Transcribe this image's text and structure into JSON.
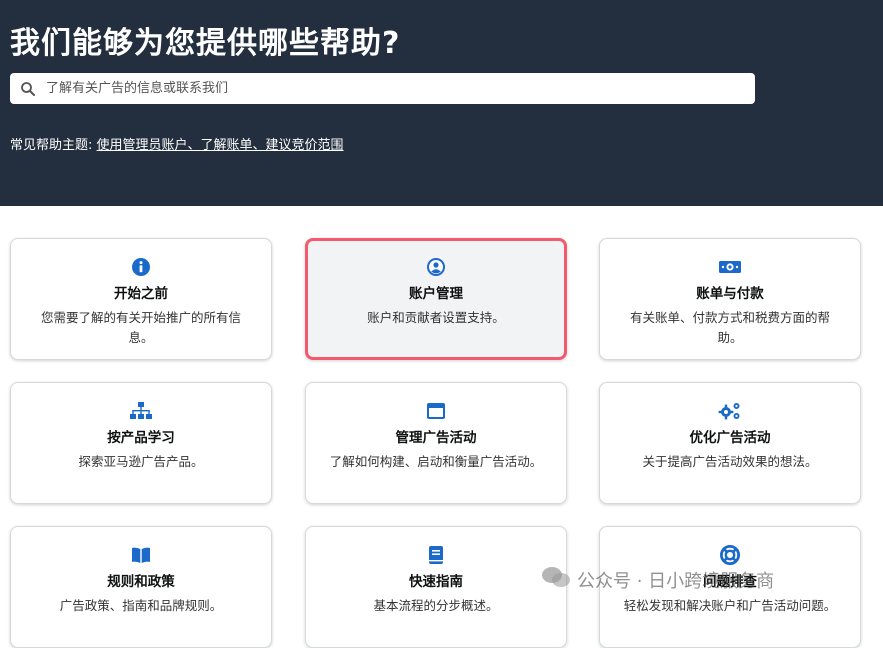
{
  "hero": {
    "title": "我们能够为您提供哪些帮助?",
    "search_placeholder": "了解有关广告的信息或联系我们",
    "topics_prefix": "常见帮助主题:",
    "topics_link": "使用管理员账户、了解账单、建议竞价范围"
  },
  "colors": {
    "hero_bg": "#232f3e",
    "icon_blue": "#1b6ac9",
    "selected_border": "#f25a6e"
  },
  "cards": [
    {
      "icon": "info-icon",
      "title": "开始之前",
      "desc": "您需要了解的有关开始推广的所有信息。"
    },
    {
      "icon": "user-circle-icon",
      "title": "账户管理",
      "desc": "账户和贡献者设置支持。"
    },
    {
      "icon": "money-icon",
      "title": "账单与付款",
      "desc": "有关账单、付款方式和税费方面的帮助。"
    },
    {
      "icon": "sitemap-icon",
      "title": "按产品学习",
      "desc": "探索亚马逊广告产品。"
    },
    {
      "icon": "window-icon",
      "title": "管理广告活动",
      "desc": "了解如何构建、启动和衡量广告活动。"
    },
    {
      "icon": "gears-icon",
      "title": "优化广告活动",
      "desc": "关于提高广告活动效果的想法。"
    },
    {
      "icon": "book-icon",
      "title": "规则和政策",
      "desc": "广告政策、指南和品牌规则。"
    },
    {
      "icon": "guide-icon",
      "title": "快速指南",
      "desc": "基本流程的分步概述。"
    },
    {
      "icon": "lifebuoy-icon",
      "title": "问题排查",
      "desc": "轻松发现和解决账户和广告活动问题。"
    }
  ],
  "watermark": {
    "text": "公众号 · 日小跨境服务商"
  }
}
